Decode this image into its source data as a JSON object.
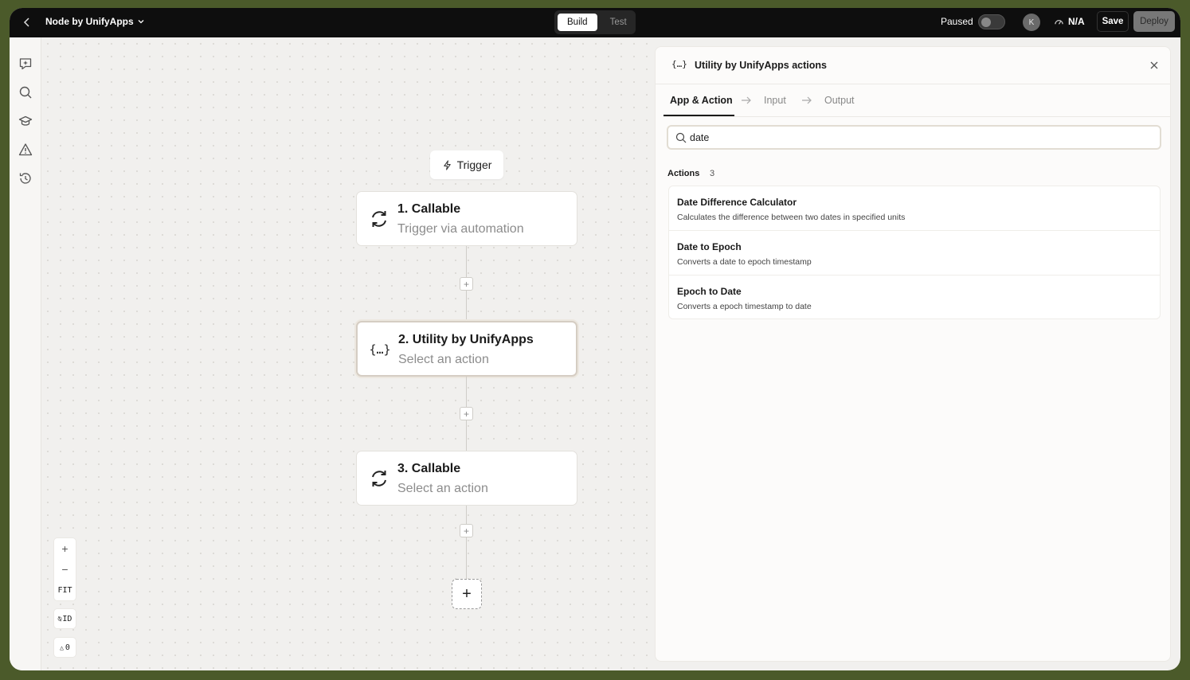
{
  "topbar": {
    "app_title": "Node by UnifyApps",
    "modes": [
      "Build",
      "Test"
    ],
    "active_mode": "Build",
    "paused_label": "Paused",
    "avatar_initial": "K",
    "perf_label": "N/A",
    "save_label": "Save",
    "deploy_label": "Deploy"
  },
  "rail": {
    "icons": [
      "ai-chat-icon",
      "search-icon",
      "learn-icon",
      "warning-icon",
      "history-icon"
    ]
  },
  "canvas": {
    "trigger_label": "Trigger",
    "nodes": [
      {
        "title": "1. Callable",
        "subtitle": "Trigger via automation",
        "icon": "sync-icon"
      },
      {
        "title": "2. Utility by UnifyApps",
        "subtitle": "Select an action",
        "icon": "braces-icon"
      },
      {
        "title": "3. Callable",
        "subtitle": "Select an action",
        "icon": "sync-icon"
      }
    ],
    "add_symbol": "+",
    "zoom_in": "+",
    "zoom_out": "−",
    "fit_label": "FIT",
    "id_label": "ID",
    "warnings_label": "0"
  },
  "panel": {
    "icon_glyph": "{…}",
    "title": "Utility by UnifyApps actions",
    "steps": [
      "App & Action",
      "Input",
      "Output"
    ],
    "search_value": "date",
    "actions_label": "Actions",
    "actions_count": "3",
    "actions": [
      {
        "title": "Date Difference Calculator",
        "desc": "Calculates the difference between two dates in specified units"
      },
      {
        "title": "Date to Epoch",
        "desc": "Converts a date to epoch timestamp"
      },
      {
        "title": "Epoch to Date",
        "desc": "Converts a epoch timestamp to date"
      }
    ]
  }
}
